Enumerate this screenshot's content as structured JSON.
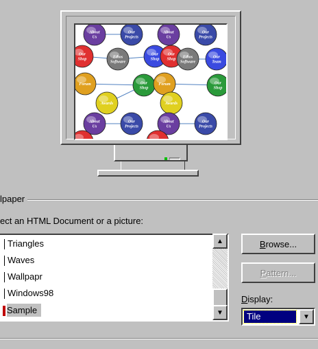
{
  "wallpaper": {
    "group_label": "lpaper",
    "instruction": "ect an HTML Document or a picture:",
    "items": [
      {
        "label": "Triangles",
        "selected": false
      },
      {
        "label": "Waves",
        "selected": false
      },
      {
        "label": "Wallpapr",
        "selected": false
      },
      {
        "label": "Windows98",
        "selected": false
      },
      {
        "label": "Sample",
        "selected": true
      }
    ]
  },
  "buttons": {
    "browse": {
      "prefix": "",
      "accel": "B",
      "rest": "rowse..."
    },
    "pattern": {
      "prefix": "",
      "accel": "P",
      "rest": "attern..."
    }
  },
  "display": {
    "label_accel": "D",
    "label_rest": "isplay:",
    "value": "Tile"
  },
  "preview": {
    "bubbles": [
      {
        "label": "About Us",
        "color": "#6a3ea0"
      },
      {
        "label": "Our Projects",
        "color": "#3a4aa8"
      },
      {
        "label": "About Us",
        "color": "#6a3ea0"
      },
      {
        "label": "Our Projects",
        "color": "#3a4aa8"
      },
      {
        "label": "Our Shop",
        "color": "#e03030"
      },
      {
        "label": "Ethos Software",
        "color": "#7a7a7a"
      },
      {
        "label": "Our Shop",
        "color": "#3a4ae0"
      },
      {
        "label": "Our Shop",
        "color": "#e03030"
      },
      {
        "label": "Ethos Software",
        "color": "#7a7a7a"
      },
      {
        "label": "Our Team",
        "color": "#3a4ae0"
      },
      {
        "label": "Forum",
        "color": "#e0a020"
      },
      {
        "label": "Our Shop",
        "color": "#2a9a3a"
      },
      {
        "label": "Forum",
        "color": "#e0a020"
      },
      {
        "label": "Our Shop",
        "color": "#2a9a3a"
      },
      {
        "label": "Awards",
        "color": "#e0d020"
      },
      {
        "label": "Awards",
        "color": "#e0d020"
      },
      {
        "label": "About Us",
        "color": "#6a3ea0"
      },
      {
        "label": "Our Projects",
        "color": "#3a4aa8"
      },
      {
        "label": "About Us",
        "color": "#6a3ea0"
      },
      {
        "label": "Our Projects",
        "color": "#3a4aa8"
      },
      {
        "label": "Our",
        "color": "#e03030"
      },
      {
        "label": "Our",
        "color": "#e03030"
      }
    ]
  }
}
